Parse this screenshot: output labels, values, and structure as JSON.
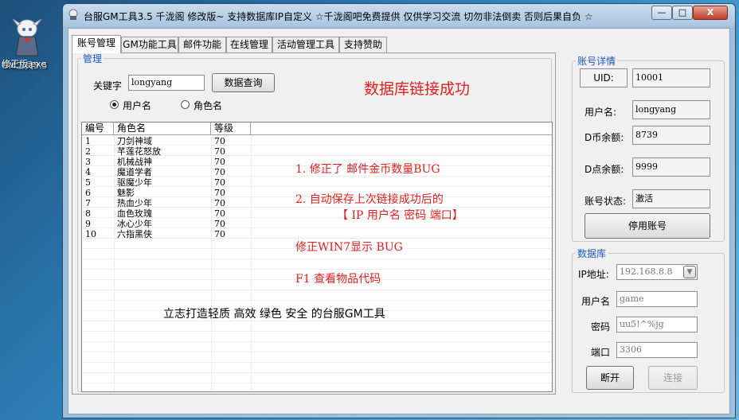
{
  "desktop": {
    "icon_label_line1": "GM工具3.5",
    "icon_label_line2": "修正版.exe"
  },
  "window": {
    "title": "台服GM工具3.5  千泷阁 修改版~  支持数据库IP自定义  ☆千泷阁吧免费提供 仅供学习交流 切勿非法倒卖 否则后果自负 ☆",
    "min_label": "—",
    "max_label": "□",
    "close_label": "X"
  },
  "tabs": [
    "账号管理",
    "GM功能工具",
    "邮件功能",
    "在线管理",
    "活动管理工具",
    "支持赞助"
  ],
  "manage": {
    "legend": "管理",
    "keyword_label": "关键字",
    "keyword_value": "longyang",
    "query_button": "数据查询",
    "status": "数据库链接成功",
    "radio_user": "用户名",
    "radio_role": "角色名",
    "columns": [
      "编号",
      "角色名",
      "等级"
    ],
    "rows": [
      {
        "id": "1",
        "name": "刀剑神域",
        "level": "70"
      },
      {
        "id": "2",
        "name": "芊莲花怒放",
        "level": "70"
      },
      {
        "id": "3",
        "name": "机械战神",
        "level": "70"
      },
      {
        "id": "4",
        "name": "魔道学者",
        "level": "70"
      },
      {
        "id": "5",
        "name": "驱魔少年",
        "level": "70"
      },
      {
        "id": "6",
        "name": "魅影",
        "level": "70"
      },
      {
        "id": "7",
        "name": "热血少年",
        "level": "70"
      },
      {
        "id": "8",
        "name": "血色玫瑰",
        "level": "70"
      },
      {
        "id": "9",
        "name": "冰心少年",
        "level": "70"
      },
      {
        "id": "10",
        "name": "六指黑侠",
        "level": "70"
      }
    ],
    "notes": [
      "1. 修正了 邮件金币数量BUG",
      "2. 自动保存上次链接成功后的",
      "【 IP 用户名 密码 端口】",
      "修正WIN7显示 BUG",
      "F1 查看物品代码"
    ],
    "slogan": "立志打造轻质 高效 绿色 安全 的台服GM工具"
  },
  "account": {
    "legend": "账号详情",
    "uid_label": "UID:",
    "uid_value": "10001",
    "user_label": "用户名:",
    "user_value": "longyang",
    "dcoin_label": "D币余额:",
    "dcoin_value": "8739",
    "dpoint_label": "D点余额:",
    "dpoint_value": "9999",
    "status_label": "账号状态:",
    "status_value": "激活",
    "disable_button": "停用账号"
  },
  "database": {
    "legend": "数据库",
    "ip_label": "IP地址:",
    "ip_value": "192.168.8.8",
    "user_label": "用户名",
    "user_value": "game",
    "pass_label": "密码",
    "pass_value": "uu5!^%jg",
    "port_label": "端口",
    "port_value": "3306",
    "disconnect_button": "断开",
    "connect_button": "连接"
  }
}
